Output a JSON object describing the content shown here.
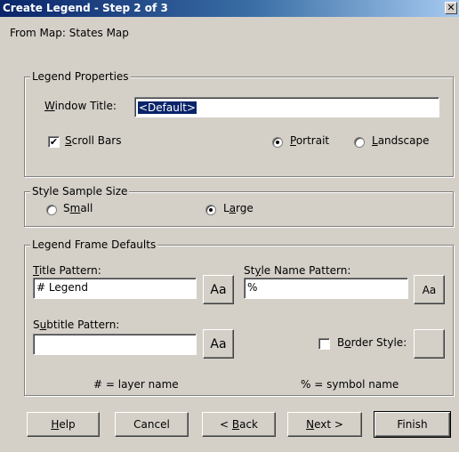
{
  "window": {
    "title": "Create Legend - Step 2 of 3",
    "close_glyph": "✕"
  },
  "from_map": {
    "label": "From Map:",
    "value": "States Map"
  },
  "legend_properties": {
    "group_label": "Legend Properties",
    "window_title_label_u": "W",
    "window_title_label_rest": "indow Title:",
    "window_title_value": "<Default>",
    "scroll_bars_u": "S",
    "scroll_bars_rest": "croll Bars",
    "scroll_bars_checked": true,
    "portrait_u": "P",
    "portrait_rest": "ortrait",
    "landscape_u": "L",
    "landscape_rest": "andscape",
    "orientation_selected": "Portrait"
  },
  "style_sample_size": {
    "group_label": "Style Sample Size",
    "small_pre": "S",
    "small_u": "m",
    "small_post": "all",
    "large_pre": "L",
    "large_u": "a",
    "large_post": "rge",
    "selected": "Large"
  },
  "legend_frame_defaults": {
    "group_label": "Legend Frame Defaults",
    "title_pattern_u": "T",
    "title_pattern_rest": "itle Pattern:",
    "title_pattern_value": "# Legend",
    "font_button_label": "Aa",
    "style_name_pre": "St",
    "style_name_u": "y",
    "style_name_post": "le Name Pattern:",
    "style_name_value": "%",
    "subtitle_pre": "S",
    "subtitle_u": "u",
    "subtitle_post": "btitle Pattern:",
    "subtitle_value": "",
    "border_style_pre": "B",
    "border_style_u": "o",
    "border_style_post": "rder Style:",
    "border_style_checked": false,
    "layer_note": "# = layer name",
    "symbol_note": "% = symbol name"
  },
  "buttons": {
    "help_u": "H",
    "help_rest": "elp",
    "cancel": "Cancel",
    "back_pre": "< ",
    "back_u": "B",
    "back_rest": "ack",
    "next_u": "N",
    "next_rest": "ext >",
    "finish": "Finish"
  },
  "colors": {
    "title_bar": "#0a246a",
    "dialog_bg": "#d4d0c8",
    "selection": "#0a246a"
  },
  "icons": {
    "close": "close-icon",
    "check": "checkmark-icon",
    "radio": "radio-dot-icon"
  }
}
